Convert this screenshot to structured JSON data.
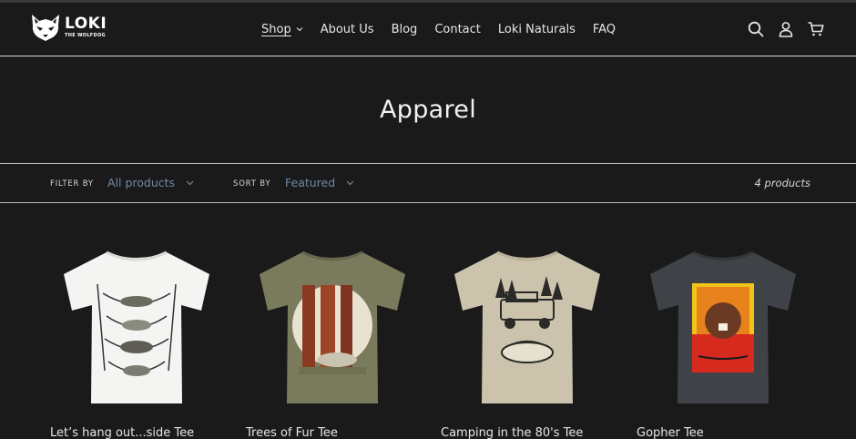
{
  "brand": {
    "name": "LOKI",
    "tagline": "THE WOLFDOG"
  },
  "nav": {
    "items": [
      {
        "label": "Shop",
        "active": true,
        "has_dropdown": true
      },
      {
        "label": "About Us"
      },
      {
        "label": "Blog"
      },
      {
        "label": "Contact"
      },
      {
        "label": "Loki Naturals"
      },
      {
        "label": "FAQ"
      }
    ]
  },
  "header_icons": [
    "search-icon",
    "account-icon",
    "cart-icon"
  ],
  "collection": {
    "title": "Apparel"
  },
  "filter_bar": {
    "filter_label": "Filter by",
    "filter_value": "All products",
    "sort_label": "Sort by",
    "sort_value": "Featured",
    "product_count": "4 products"
  },
  "products": [
    {
      "title": "Let’s hang out...side Tee",
      "shirt_color": "#f4f4f2",
      "art": "hammocks"
    },
    {
      "title": "Trees of Fur Tee",
      "shirt_color": "#7a7a5c",
      "art": "redwoods"
    },
    {
      "title": "Camping in the 80's Tee",
      "shirt_color": "#cbc3ac",
      "art": "truck"
    },
    {
      "title": "Gopher Tee",
      "shirt_color": "#3f4347",
      "art": "gopher"
    }
  ],
  "colors": {
    "background": "#1b1a1a",
    "text": "#e6e6e6",
    "select_accent": "#6e8aa6",
    "divider": "#bdbdbd"
  }
}
